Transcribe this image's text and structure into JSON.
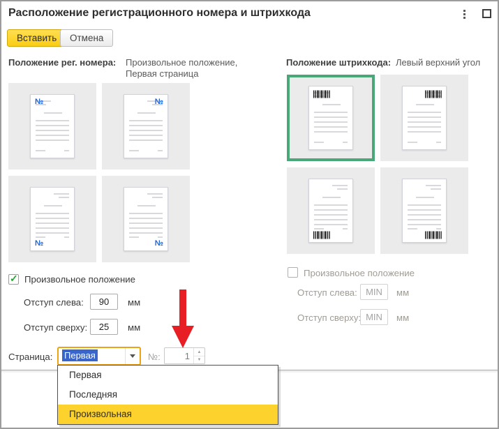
{
  "window": {
    "title": "Расположение регистрационного номера и штрихкода"
  },
  "toolbar": {
    "insert_label": "Вставить",
    "cancel_label": "Отмена"
  },
  "reg": {
    "header_label": "Положение рег. номера:",
    "header_value_line1": "Произвольное положение,",
    "header_value_line2": "Первая страница",
    "marker": "№",
    "tiles": [
      {
        "position": "top-left",
        "selected": false
      },
      {
        "position": "top-right",
        "selected": false
      },
      {
        "position": "bottom-left",
        "selected": false
      },
      {
        "position": "bottom-right",
        "selected": false
      }
    ],
    "checkbox_label": "Произвольное положение",
    "checkbox_checked": true,
    "offset_left_label": "Отступ слева:",
    "offset_left_value": "90",
    "offset_top_label": "Отступ сверху:",
    "offset_top_value": "25",
    "unit": "мм",
    "page_label": "Страница:",
    "page_value": "Первая",
    "number_label": "№:",
    "number_value": "1"
  },
  "barcode": {
    "header_label": "Положение штрихкода:",
    "header_value": "Левый верхний угол",
    "tiles": [
      {
        "position": "top-left",
        "selected": true
      },
      {
        "position": "top-right",
        "selected": false
      },
      {
        "position": "bottom-left",
        "selected": false
      },
      {
        "position": "bottom-right",
        "selected": false
      }
    ],
    "checkbox_label": "Произвольное положение",
    "checkbox_checked": false,
    "offset_left_label": "Отступ слева:",
    "offset_left_value": "MIN",
    "offset_top_label": "Отступ сверху:",
    "offset_top_value": "MIN",
    "unit": "мм"
  },
  "page_dropdown": {
    "items": [
      {
        "label": "Первая",
        "highlighted": false
      },
      {
        "label": "Последняя",
        "highlighted": false
      },
      {
        "label": "Произвольная",
        "highlighted": true
      }
    ]
  },
  "colors": {
    "accent_yellow": "#fbcd14",
    "focus_border": "#eda412",
    "selection_blue": "#3a66cc",
    "highlight_yellow": "#fdd22c",
    "selected_tile_green": "#4aa878",
    "check_green": "#21a72f",
    "arrow_red": "#e81e25",
    "reg_number_blue": "#1e63d6"
  }
}
